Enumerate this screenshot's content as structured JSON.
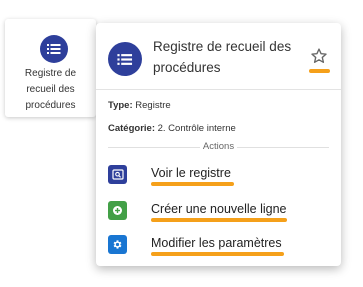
{
  "colors": {
    "primary": "#2e3f9b",
    "green": "#43a047",
    "blue": "#1976d2",
    "highlight": "#f5a01a",
    "star_outline": "#666666"
  },
  "tile": {
    "icon": "list-icon",
    "label": "Registre de recueil des procédures"
  },
  "popup": {
    "icon": "list-icon",
    "title": "Registre de recueil des procédures",
    "favorite_icon": "star-outline-icon",
    "type_label": "Type:",
    "type_value": "Registre",
    "category_label": "Catégorie:",
    "category_value": "2. Contrôle interne",
    "actions_heading": "Actions",
    "actions": [
      {
        "label": "Voir le registre",
        "icon": "view-register-icon",
        "color": "#2e3f9b"
      },
      {
        "label": "Créer une nouvelle ligne",
        "icon": "plus-circle-icon",
        "color": "#43a047"
      },
      {
        "label": "Modifier les paramètres",
        "icon": "gear-icon",
        "color": "#1976d2"
      }
    ]
  }
}
